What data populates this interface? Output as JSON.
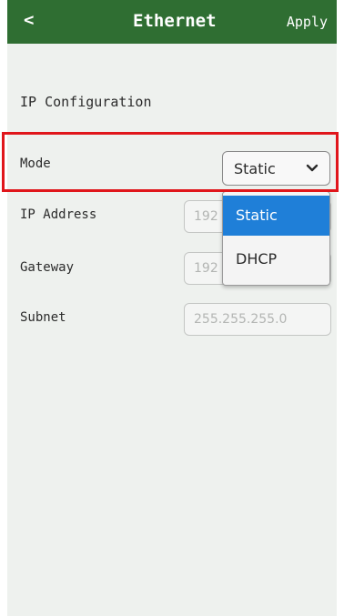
{
  "header": {
    "back_label": "<",
    "title": "Ethernet",
    "apply_label": "Apply",
    "background_color": "#2f6e32"
  },
  "section": {
    "title": "IP Configuration"
  },
  "mode": {
    "label": "Mode",
    "selected_value": "Static",
    "options": [
      "Static",
      "DHCP"
    ],
    "highlight_color": "#e0161b"
  },
  "ip_address": {
    "label": "IP Address",
    "value": "192"
  },
  "gateway": {
    "label": "Gateway",
    "value": "192"
  },
  "subnet": {
    "label": "Subnet",
    "value": "255.255.255.0"
  },
  "colors": {
    "selected_option": "#1f7fd8",
    "screen_background": "#eef1ee"
  },
  "icons": {
    "back": "back-chevron",
    "mode_select": "chevron-down-icon"
  }
}
